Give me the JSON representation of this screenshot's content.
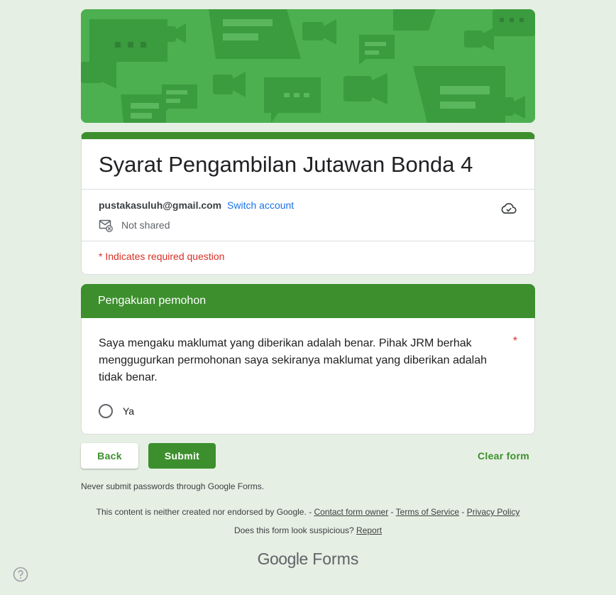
{
  "form": {
    "title": "Syarat Pengambilan Jutawan Bonda 4",
    "account_email": "pustakasuluh@gmail.com",
    "switch_account": "Switch account",
    "share_status": "Not shared",
    "required_note": "* Indicates required question"
  },
  "section": {
    "title": "Pengakuan pemohon"
  },
  "question": {
    "text": "Saya mengaku maklumat yang diberikan adalah benar. Pihak JRM berhak menggugurkan permohonan saya sekiranya maklumat yang diberikan adalah tidak benar.",
    "required_marker": "*",
    "options": [
      {
        "label": "Ya",
        "selected": false
      }
    ]
  },
  "buttons": {
    "back": "Back",
    "submit": "Submit",
    "clear": "Clear form"
  },
  "footer": {
    "password_note": "Never submit passwords through Google Forms.",
    "disclaimer": "This content is neither created nor endorsed by Google.",
    "contact": "Contact form owner",
    "terms": "Terms of Service",
    "privacy": "Privacy Policy",
    "suspicious": "Does this form look suspicious?",
    "report": "Report",
    "brand_google": "Google",
    "brand_forms": "Forms"
  },
  "colors": {
    "theme": "#3d8f2e",
    "background": "#e6efe3",
    "required": "#d93025",
    "link": "#1a73e8"
  },
  "icons": [
    "cloud-check-icon",
    "mail-icon",
    "help-icon"
  ]
}
